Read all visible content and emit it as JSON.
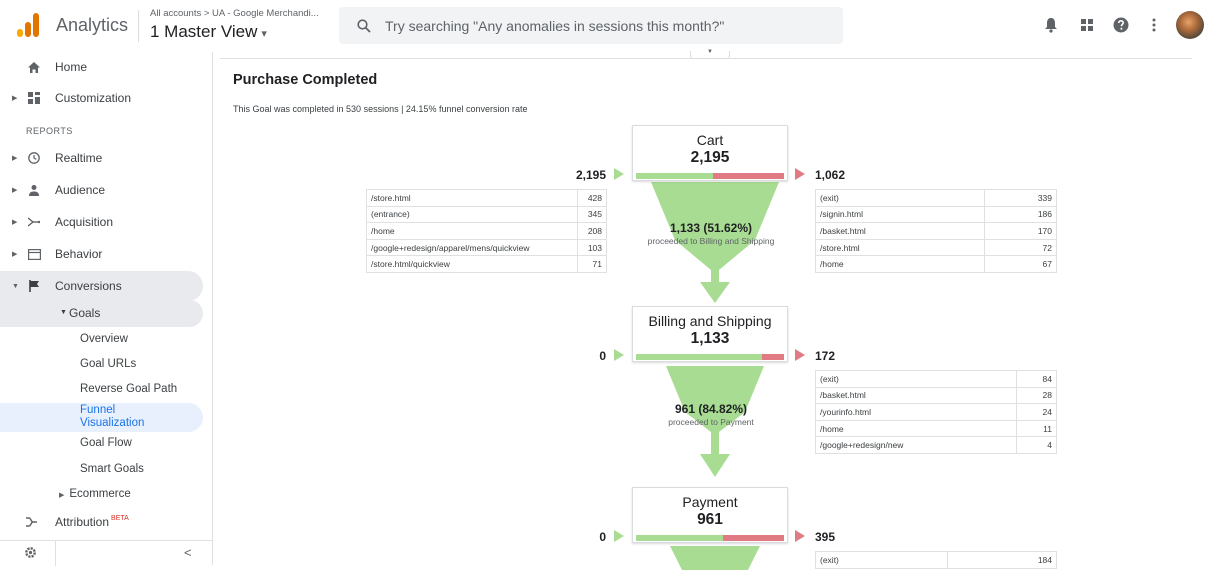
{
  "header": {
    "app_name": "Analytics",
    "breadcrumb": "All accounts > UA - Google Merchandi...",
    "view_name": "1 Master View",
    "view_caret": "▾",
    "search_placeholder": "Try searching \"Any anomalies in sessions this month?\"",
    "logo_colors": [
      "#f9ab00",
      "#e37400",
      "#e37400"
    ]
  },
  "sidebar": {
    "home": "Home",
    "customization": "Customization",
    "reports_label": "REPORTS",
    "realtime": "Realtime",
    "audience": "Audience",
    "acquisition": "Acquisition",
    "behavior": "Behavior",
    "conversions": "Conversions",
    "goals": "Goals",
    "goal_items": [
      "Overview",
      "Goal URLs",
      "Reverse Goal Path",
      "Funnel\nVisualization",
      "Goal Flow",
      "Smart Goals"
    ],
    "funnel_line1": "Funnel",
    "funnel_line2": "Visualization",
    "ecommerce": "Ecommerce",
    "attribution": "Attribution",
    "attribution_badge": "BETA",
    "collapse": "<"
  },
  "main": {
    "title": "Purchase Completed",
    "summary": "This Goal was completed in 530 sessions | 24.15% funnel conversion rate"
  },
  "funnel": {
    "steps": [
      {
        "name": "Cart",
        "value": "2,195",
        "entrances": "2,195",
        "exits": "1,062",
        "progress_fraction": 0.52,
        "proceed_value": "1,133 (51.62%)",
        "proceed_label": "proceeded to Billing and Shipping",
        "entrance_rows": [
          [
            "/store.html",
            "428"
          ],
          [
            "(entrance)",
            "345"
          ],
          [
            "/home",
            "208"
          ],
          [
            "/google+redesign/apparel/mens/quickview",
            "103"
          ],
          [
            "/store.html/quickview",
            "71"
          ]
        ],
        "exit_rows": [
          [
            "(exit)",
            "339"
          ],
          [
            "/signin.html",
            "186"
          ],
          [
            "/basket.html",
            "170"
          ],
          [
            "/store.html",
            "72"
          ],
          [
            "/home",
            "67"
          ]
        ]
      },
      {
        "name": "Billing and Shipping",
        "value": "1,133",
        "entrances": "0",
        "exits": "172",
        "progress_fraction": 0.85,
        "proceed_value": "961 (84.82%)",
        "proceed_label": "proceeded to Payment",
        "exit_rows": [
          [
            "(exit)",
            "84"
          ],
          [
            "/basket.html",
            "28"
          ],
          [
            "/yourinfo.html",
            "24"
          ],
          [
            "/home",
            "11"
          ],
          [
            "/google+redesign/new",
            "4"
          ]
        ]
      },
      {
        "name": "Payment",
        "value": "961",
        "entrances": "0",
        "exits": "395",
        "progress_fraction": 0.59,
        "exit_rows": [
          [
            "(exit)",
            "184"
          ]
        ]
      }
    ],
    "colors": {
      "continue": "#a8dc92",
      "exit": "#e07b84"
    }
  }
}
